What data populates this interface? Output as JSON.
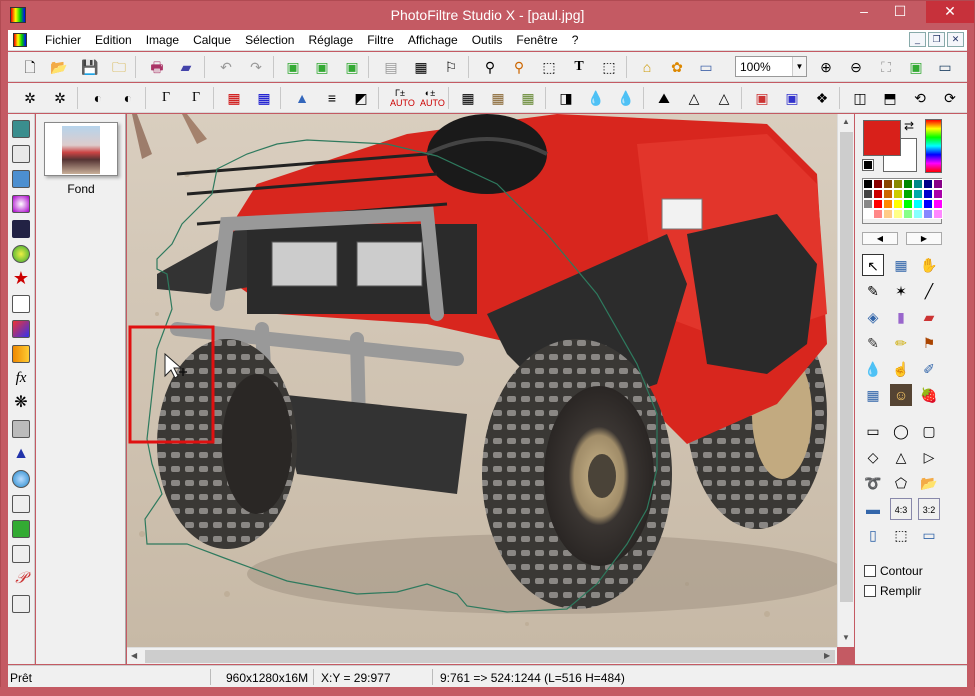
{
  "window": {
    "title": "PhotoFiltre Studio X - [paul.jpg]",
    "minimize": "–",
    "maximize": "☐",
    "close": "✕"
  },
  "menu": {
    "items": [
      "Fichier",
      "Edition",
      "Image",
      "Calque",
      "Sélection",
      "Réglage",
      "Filtre",
      "Affichage",
      "Outils",
      "Fenêtre",
      "?"
    ]
  },
  "toolbar": {
    "zoom_value": "100%"
  },
  "layers": {
    "name": "Fond"
  },
  "right_panel": {
    "contour_label": "Contour",
    "fill_label": "Remplir",
    "foreground_color": "#d8201a",
    "background_color": "#ffffff"
  },
  "status": {
    "state": "Prêt",
    "image_info": "960x1280x16M",
    "cursor": "X:Y = 29:977",
    "selection": "9:761 => 524:1244 (L=516  H=484)"
  },
  "colors": {
    "titlebar": "#c45a63",
    "close_button": "#c7313b",
    "highlight_box": "#e01010"
  }
}
